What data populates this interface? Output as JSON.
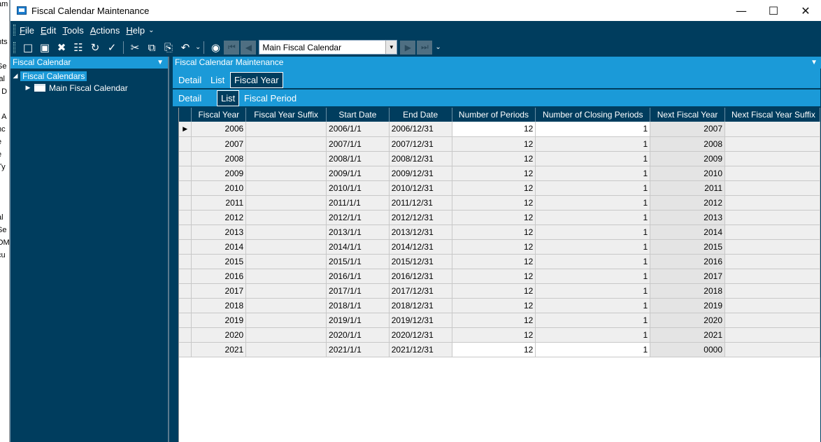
{
  "background_window": {
    "fragments": [
      "am",
      "nts",
      "Se",
      "ial",
      "t D",
      "r A",
      "nc",
      "e",
      "e",
      "Ty",
      "al",
      "Se",
      "OM",
      "cu"
    ]
  },
  "window": {
    "title": "Fiscal Calendar Maintenance"
  },
  "menu": {
    "items": [
      "File",
      "Edit",
      "Tools",
      "Actions",
      "Help"
    ]
  },
  "toolbar": {
    "calendar_select": "Main Fiscal Calendar"
  },
  "left_panel": {
    "title": "Fiscal Calendar",
    "tree": {
      "root": "Fiscal Calendars",
      "child": "Main Fiscal Calendar"
    }
  },
  "main_panel": {
    "title": "Fiscal Calendar Maintenance",
    "tabs_top": [
      "Detail",
      "List",
      "Fiscal Year"
    ],
    "tabs_bottom": [
      "Detail",
      "List",
      "Fiscal Period"
    ]
  },
  "grid": {
    "columns": [
      "Fiscal Year",
      "Fiscal Year Suffix",
      "Start Date",
      "End Date",
      "Number of Periods",
      "Number of Closing Periods",
      "Next Fiscal Year",
      "Next Fiscal Year Suffix"
    ],
    "rows": [
      [
        "2006",
        "",
        "2006/1/1",
        "2006/12/31",
        "12",
        "1",
        "2007",
        ""
      ],
      [
        "2007",
        "",
        "2007/1/1",
        "2007/12/31",
        "12",
        "1",
        "2008",
        ""
      ],
      [
        "2008",
        "",
        "2008/1/1",
        "2008/12/31",
        "12",
        "1",
        "2009",
        ""
      ],
      [
        "2009",
        "",
        "2009/1/1",
        "2009/12/31",
        "12",
        "1",
        "2010",
        ""
      ],
      [
        "2010",
        "",
        "2010/1/1",
        "2010/12/31",
        "12",
        "1",
        "2011",
        ""
      ],
      [
        "2011",
        "",
        "2011/1/1",
        "2011/12/31",
        "12",
        "1",
        "2012",
        ""
      ],
      [
        "2012",
        "",
        "2012/1/1",
        "2012/12/31",
        "12",
        "1",
        "2013",
        ""
      ],
      [
        "2013",
        "",
        "2013/1/1",
        "2013/12/31",
        "12",
        "1",
        "2014",
        ""
      ],
      [
        "2014",
        "",
        "2014/1/1",
        "2014/12/31",
        "12",
        "1",
        "2015",
        ""
      ],
      [
        "2015",
        "",
        "2015/1/1",
        "2015/12/31",
        "12",
        "1",
        "2016",
        ""
      ],
      [
        "2016",
        "",
        "2016/1/1",
        "2016/12/31",
        "12",
        "1",
        "2017",
        ""
      ],
      [
        "2017",
        "",
        "2017/1/1",
        "2017/12/31",
        "12",
        "1",
        "2018",
        ""
      ],
      [
        "2018",
        "",
        "2018/1/1",
        "2018/12/31",
        "12",
        "1",
        "2019",
        ""
      ],
      [
        "2019",
        "",
        "2019/1/1",
        "2019/12/31",
        "12",
        "1",
        "2020",
        ""
      ],
      [
        "2020",
        "",
        "2020/1/1",
        "2020/12/31",
        "12",
        "1",
        "2021",
        ""
      ],
      [
        "2021",
        "",
        "2021/1/1",
        "2021/12/31",
        "12",
        "1",
        "0000",
        ""
      ]
    ]
  },
  "colors": {
    "frame": "#003d5e",
    "accent": "#1b9ad8",
    "cell": "#efefef"
  }
}
